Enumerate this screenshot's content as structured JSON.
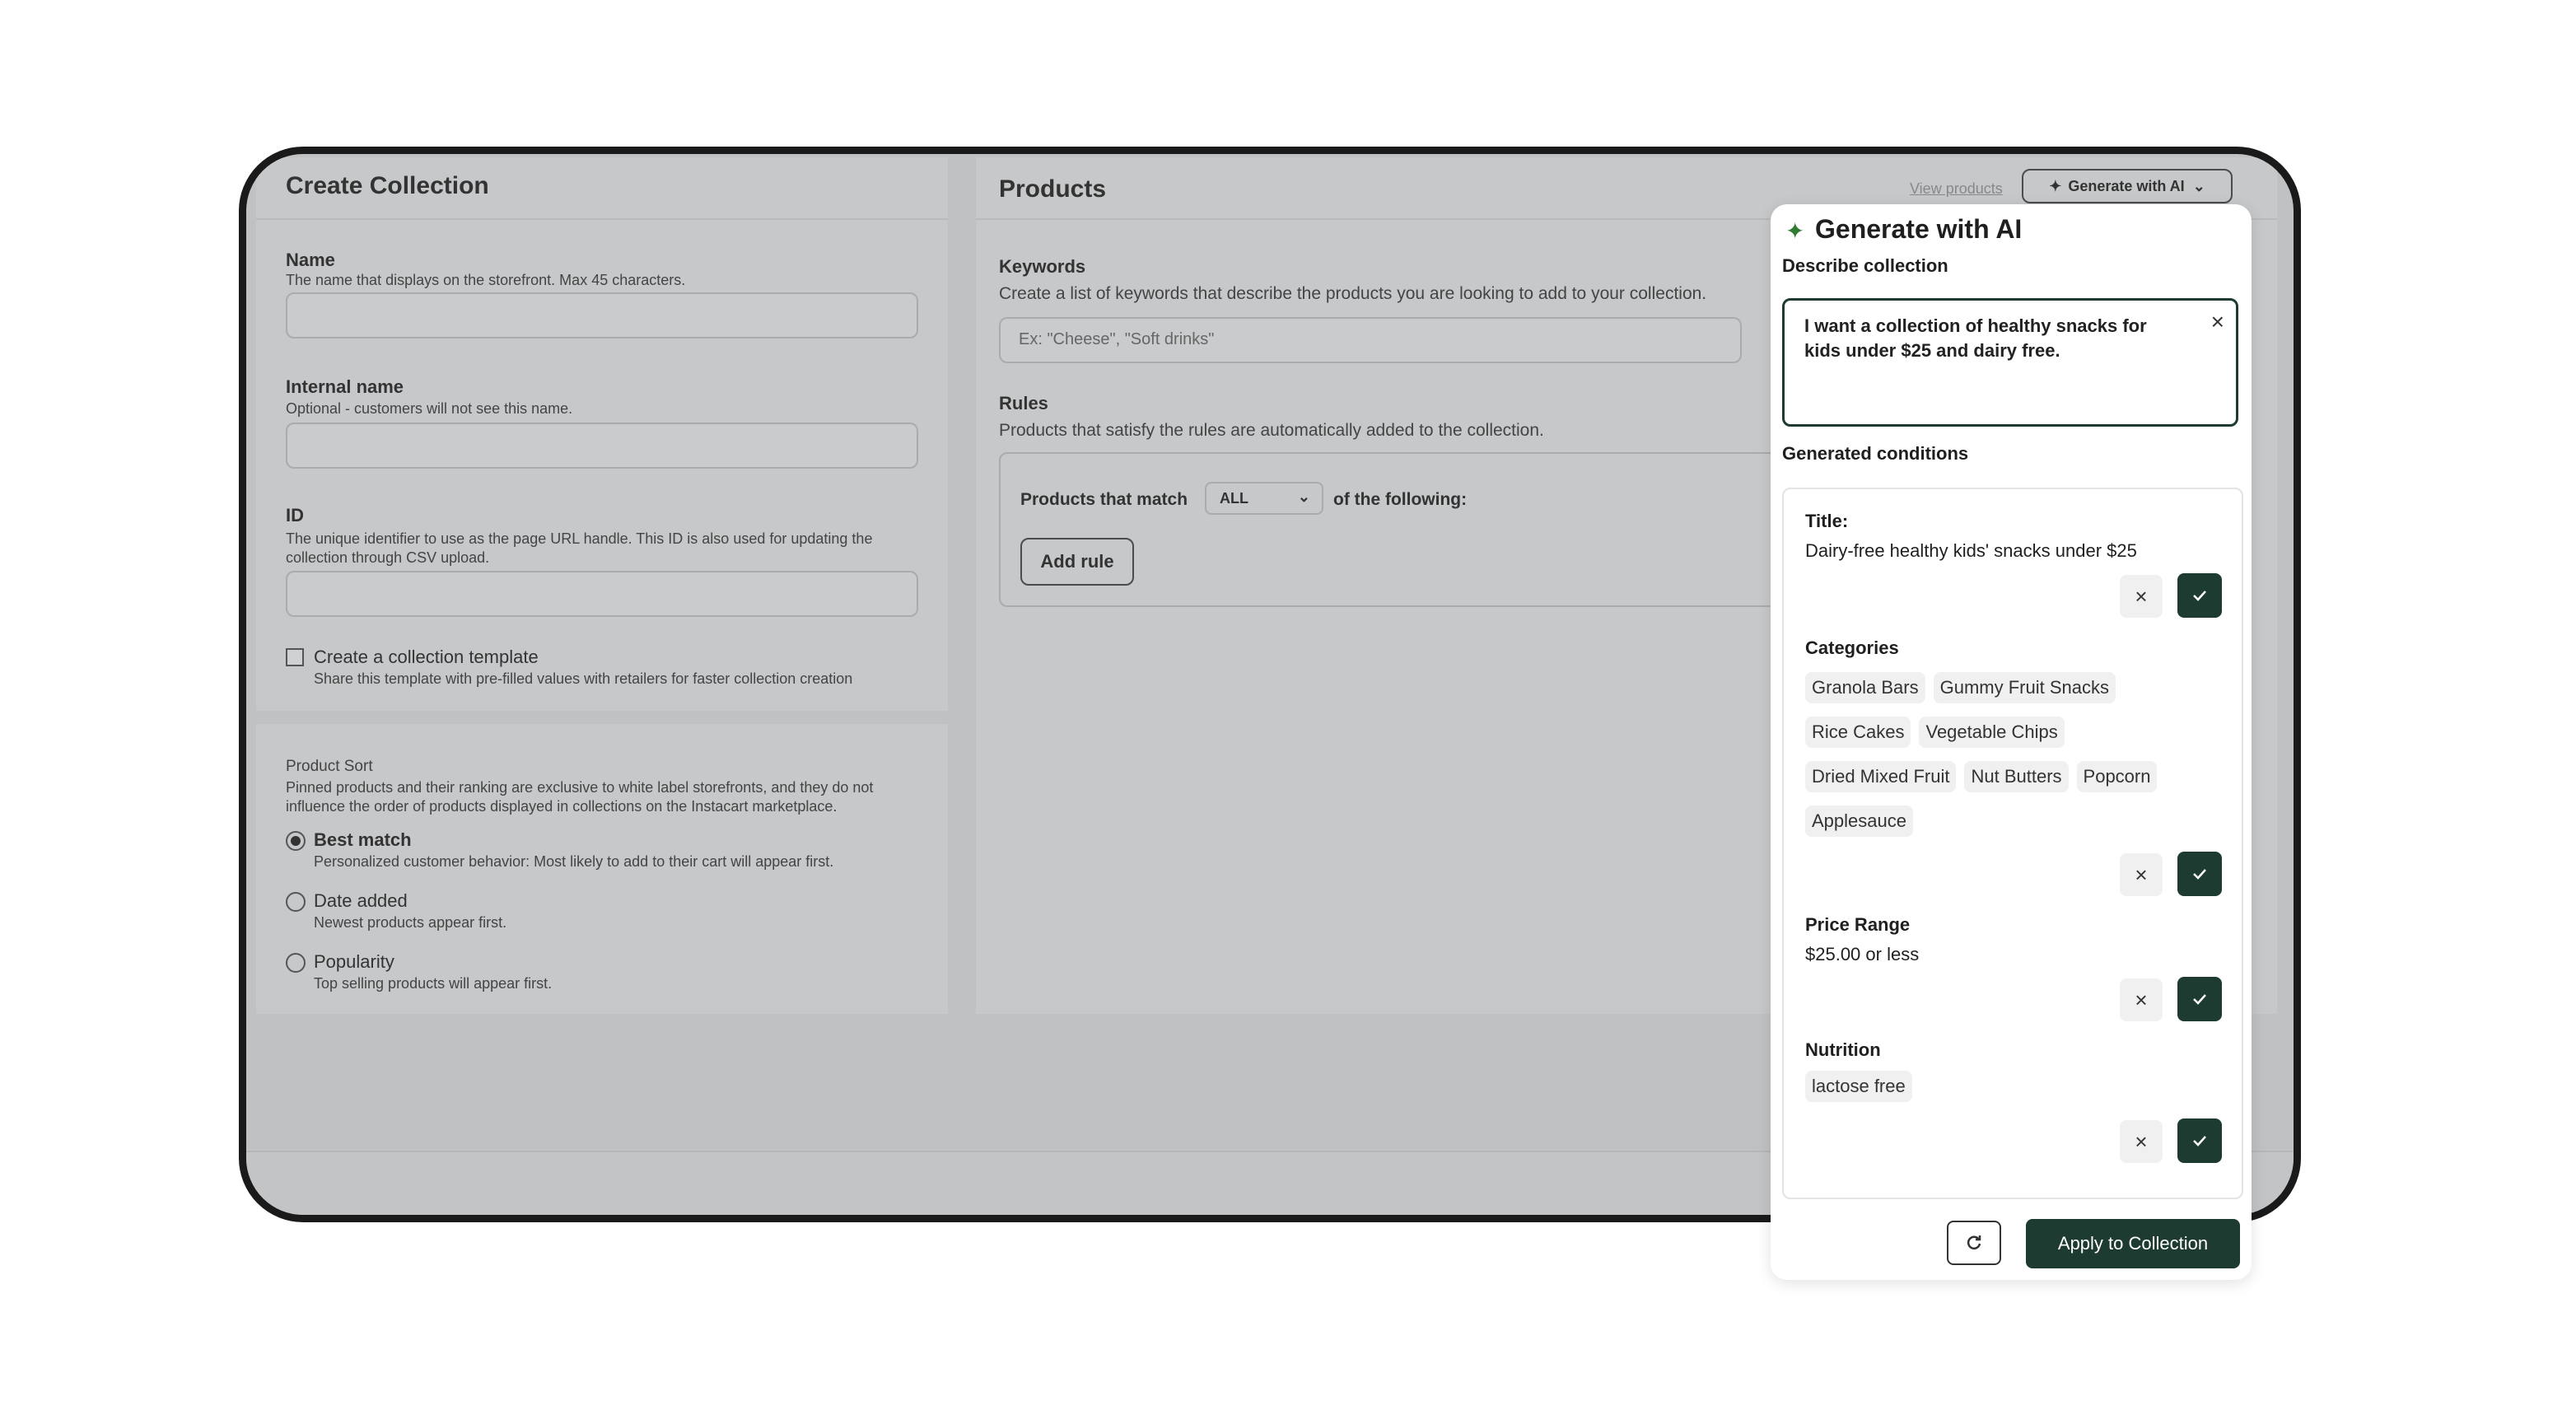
{
  "create": {
    "title": "Create Collection",
    "name_label": "Name",
    "name_hint": "The name that displays on the storefront. Max 45 characters.",
    "internal_label": "Internal name",
    "internal_hint": "Optional - customers will not see this name.",
    "id_label": "ID",
    "id_hint": "The unique identifier to use as the page URL handle. This ID is also used for updating the collection through CSV upload.",
    "template_label": "Create a collection template",
    "template_hint": "Share this template with pre-filled values with retailers for faster collection creation"
  },
  "sort": {
    "label": "Product Sort",
    "hint": "Pinned products and their ranking are exclusive to white label storefronts, and they do not influence the order of products displayed in collections on the Instacart marketplace.",
    "options": [
      {
        "label": "Best match",
        "desc": "Personalized customer behavior: Most likely to add to their cart will appear first."
      },
      {
        "label": "Date added",
        "desc": "Newest products appear first."
      },
      {
        "label": "Popularity",
        "desc": "Top selling products will appear first."
      }
    ]
  },
  "products": {
    "title": "Products",
    "view_link": "View products",
    "generate_btn": "Generate with AI",
    "keywords_label": "Keywords",
    "keywords_hint": "Create a list of keywords that describe the products you are looking to add to your collection.",
    "keywords_placeholder": "Ex: \"Cheese\", \"Soft drinks\"",
    "rules_label": "Rules",
    "rules_hint": "Products that satisfy the rules are automatically added to the collection.",
    "match_prefix": "Products that match",
    "match_value": "ALL",
    "match_suffix": "of the following:",
    "add_rule": "Add rule"
  },
  "ai": {
    "title": "Generate with AI",
    "describe_label": "Describe collection",
    "prompt": "I want a collection of healthy snacks for kids under $25 and dairy free.",
    "generated_label": "Generated conditions",
    "title_cond_label": "Title:",
    "title_cond_value": "Dairy-free healthy kids' snacks under $25",
    "categories_label": "Categories",
    "categories": [
      "Granola Bars",
      "Gummy Fruit Snacks",
      "Rice Cakes",
      "Vegetable Chips",
      "Dried Mixed Fruit",
      "Nut Butters",
      "Popcorn",
      "Applesauce"
    ],
    "price_label": "Price Range",
    "price_value": "$25.00 or less",
    "nutrition_label": "Nutrition",
    "nutrition_tag": "lactose free",
    "apply_btn": "Apply to Collection",
    "accent": "#1d3b30",
    "sparkle_color": "#2e7d32"
  }
}
